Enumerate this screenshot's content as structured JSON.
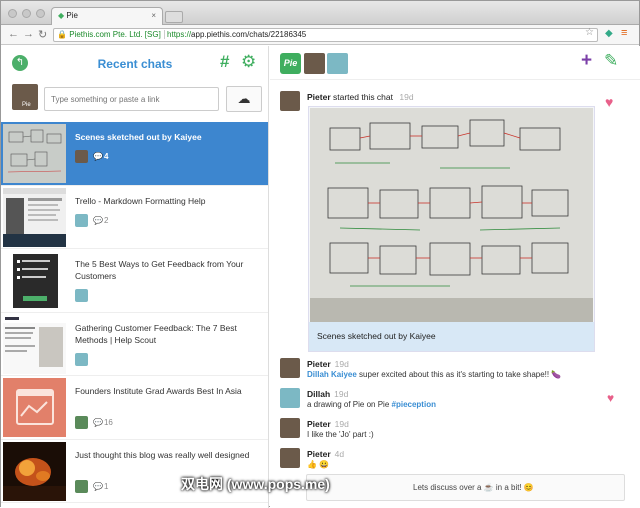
{
  "browser": {
    "tab_title": "Pie",
    "tab_close": "×",
    "ev_label": "Piethis.com Pte. Ltd. [SG]",
    "url_scheme": "https://",
    "url_rest": "app.piethis.com/chats/22186345"
  },
  "left": {
    "title": "Recent chats",
    "hash_icon": "#",
    "compose_placeholder": "Type something or paste a link",
    "my_avatar_label": "Pie",
    "items": [
      {
        "title": "Scenes sketched out by Kaiyee",
        "count": "4",
        "selected": true
      },
      {
        "title": "Trello - Markdown Formatting Help",
        "count": "2"
      },
      {
        "title": "The 5 Best Ways to Get Feedback from Your Customers",
        "count": ""
      },
      {
        "title": "Gathering Customer Feedback: The 7 Best Methods | Help Scout",
        "count": ""
      },
      {
        "title": "Founders Institute Grad Awards Best In Asia",
        "count": "16"
      },
      {
        "title": "Just thought this blog was really well designed",
        "count": "1"
      }
    ]
  },
  "right": {
    "logo": "Pie",
    "messages": [
      {
        "name": "Pieter",
        "text": "started this chat",
        "time": "19d"
      },
      {
        "name": "Pieter",
        "time": "19d",
        "mention": "Dillah Kaiyee",
        "text": "super excited about this as it's starting to take shape!! 🍆"
      },
      {
        "name": "Dillah",
        "time": "19d",
        "text": "a drawing of Pie on Pie",
        "tag": "#pieception"
      },
      {
        "name": "Pieter",
        "time": "19d",
        "text": "I like the 'Jo' part :)"
      },
      {
        "name": "Pieter",
        "time": "4d",
        "text": "👍 😀"
      }
    ],
    "card_caption": "Scenes sketched out by Kaiyee",
    "footer_text": "Lets discuss over a ☕ in a bit! 😊"
  },
  "watermark": "双电网 (www.pops.me)",
  "colors": {
    "accent": "#3d86cf",
    "brand_green": "#3fae5f",
    "heart": "#e8608a",
    "plus": "#7b3fa8"
  }
}
